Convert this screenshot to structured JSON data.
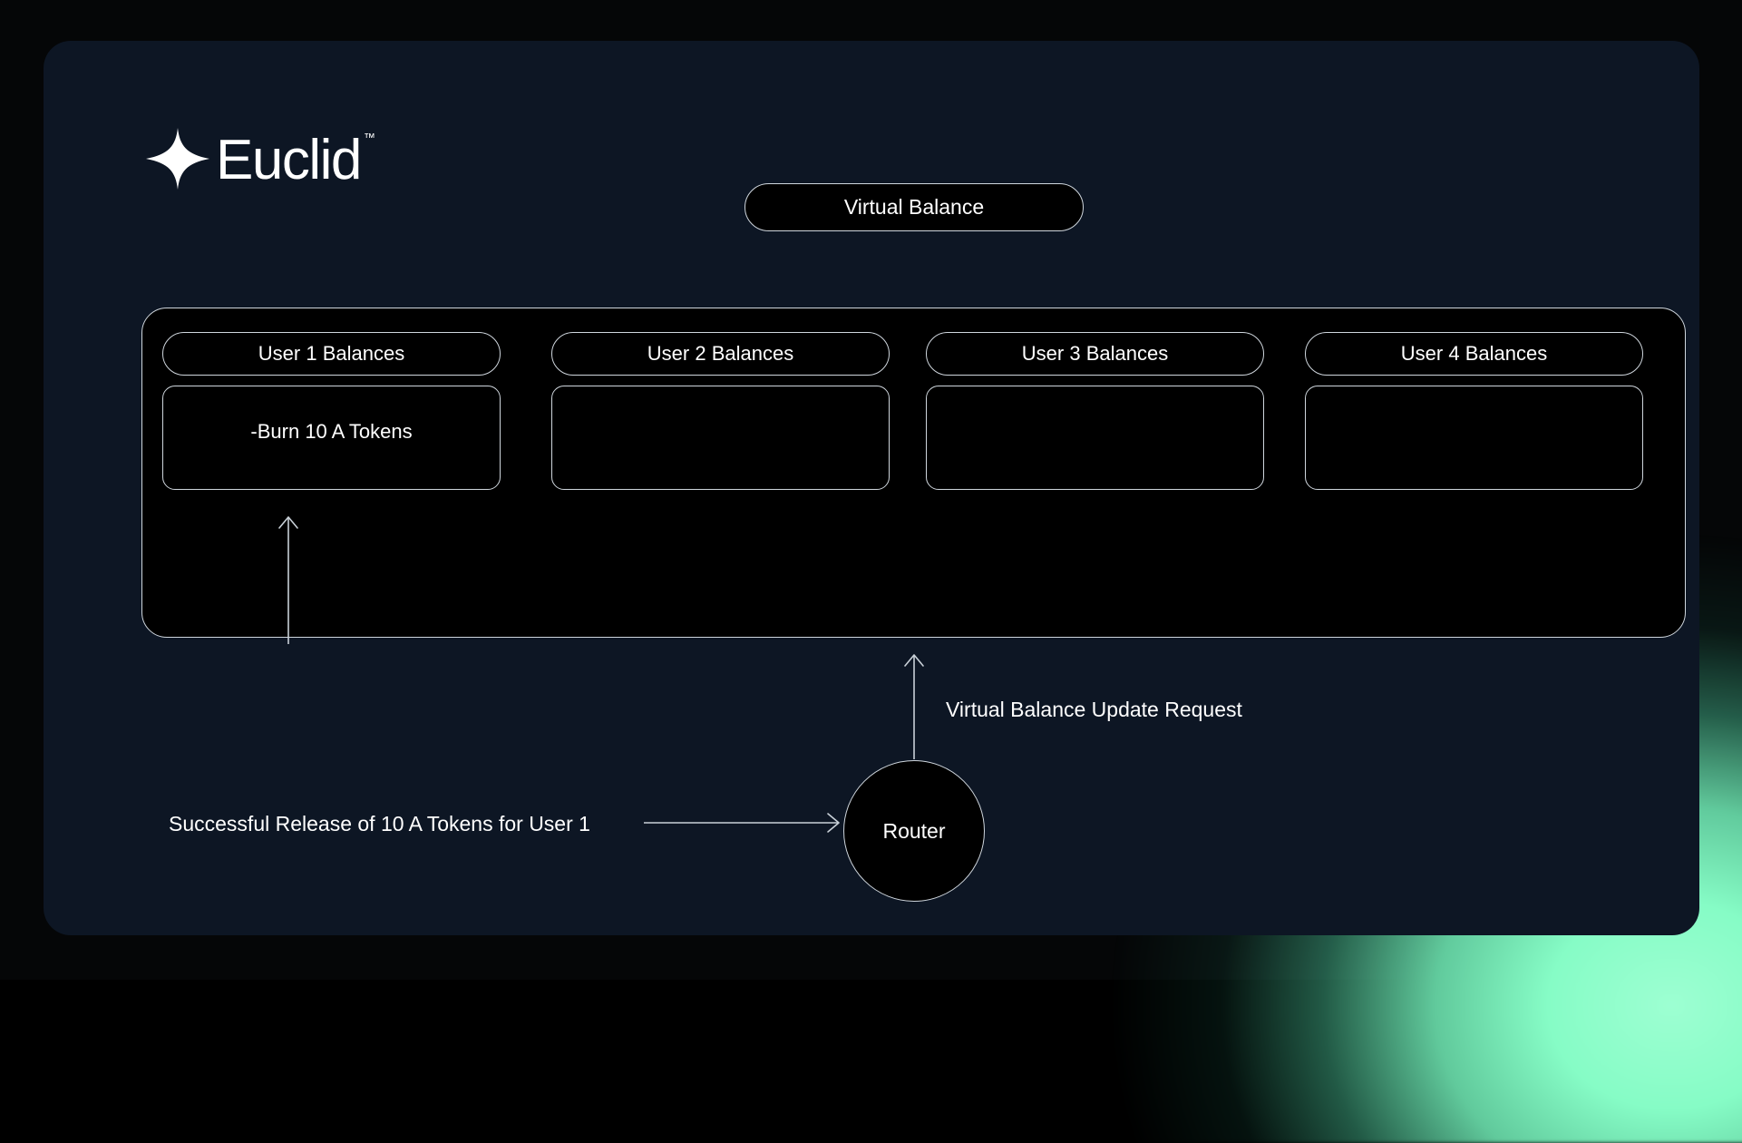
{
  "brand": {
    "name": "Euclid",
    "trademark": "™",
    "star_icon": "four-point-star-icon"
  },
  "header": {
    "virtual_balance_label": "Virtual Balance"
  },
  "balances": {
    "columns": [
      {
        "title": "User 1 Balances",
        "entry": "-Burn 10 A Tokens"
      },
      {
        "title": "User 2 Balances",
        "entry": ""
      },
      {
        "title": "User 3 Balances",
        "entry": ""
      },
      {
        "title": "User 4 Balances",
        "entry": ""
      }
    ]
  },
  "flow": {
    "update_request_label": "Virtual Balance Update Request",
    "release_label": "Successful Release of 10 A Tokens for User 1",
    "router_label": "Router"
  },
  "colors": {
    "background": "#050607",
    "card_background": "#0d1624",
    "node_fill": "#000000",
    "stroke": "#cfd6dd",
    "text": "#ffffff",
    "glow_mint": "#86fcc6",
    "glow_teal": "#3f8f7c"
  }
}
